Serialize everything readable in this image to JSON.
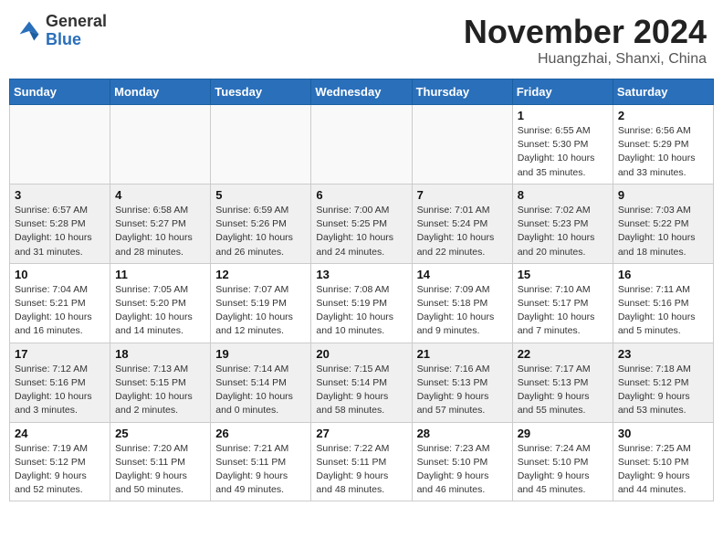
{
  "header": {
    "logo_general": "General",
    "logo_blue": "Blue",
    "month_title": "November 2024",
    "location": "Huangzhai, Shanxi, China"
  },
  "days_of_week": [
    "Sunday",
    "Monday",
    "Tuesday",
    "Wednesday",
    "Thursday",
    "Friday",
    "Saturday"
  ],
  "weeks": [
    {
      "shaded": false,
      "days": [
        {
          "num": "",
          "info": ""
        },
        {
          "num": "",
          "info": ""
        },
        {
          "num": "",
          "info": ""
        },
        {
          "num": "",
          "info": ""
        },
        {
          "num": "",
          "info": ""
        },
        {
          "num": "1",
          "info": "Sunrise: 6:55 AM\nSunset: 5:30 PM\nDaylight: 10 hours\nand 35 minutes."
        },
        {
          "num": "2",
          "info": "Sunrise: 6:56 AM\nSunset: 5:29 PM\nDaylight: 10 hours\nand 33 minutes."
        }
      ]
    },
    {
      "shaded": true,
      "days": [
        {
          "num": "3",
          "info": "Sunrise: 6:57 AM\nSunset: 5:28 PM\nDaylight: 10 hours\nand 31 minutes."
        },
        {
          "num": "4",
          "info": "Sunrise: 6:58 AM\nSunset: 5:27 PM\nDaylight: 10 hours\nand 28 minutes."
        },
        {
          "num": "5",
          "info": "Sunrise: 6:59 AM\nSunset: 5:26 PM\nDaylight: 10 hours\nand 26 minutes."
        },
        {
          "num": "6",
          "info": "Sunrise: 7:00 AM\nSunset: 5:25 PM\nDaylight: 10 hours\nand 24 minutes."
        },
        {
          "num": "7",
          "info": "Sunrise: 7:01 AM\nSunset: 5:24 PM\nDaylight: 10 hours\nand 22 minutes."
        },
        {
          "num": "8",
          "info": "Sunrise: 7:02 AM\nSunset: 5:23 PM\nDaylight: 10 hours\nand 20 minutes."
        },
        {
          "num": "9",
          "info": "Sunrise: 7:03 AM\nSunset: 5:22 PM\nDaylight: 10 hours\nand 18 minutes."
        }
      ]
    },
    {
      "shaded": false,
      "days": [
        {
          "num": "10",
          "info": "Sunrise: 7:04 AM\nSunset: 5:21 PM\nDaylight: 10 hours\nand 16 minutes."
        },
        {
          "num": "11",
          "info": "Sunrise: 7:05 AM\nSunset: 5:20 PM\nDaylight: 10 hours\nand 14 minutes."
        },
        {
          "num": "12",
          "info": "Sunrise: 7:07 AM\nSunset: 5:19 PM\nDaylight: 10 hours\nand 12 minutes."
        },
        {
          "num": "13",
          "info": "Sunrise: 7:08 AM\nSunset: 5:19 PM\nDaylight: 10 hours\nand 10 minutes."
        },
        {
          "num": "14",
          "info": "Sunrise: 7:09 AM\nSunset: 5:18 PM\nDaylight: 10 hours\nand 9 minutes."
        },
        {
          "num": "15",
          "info": "Sunrise: 7:10 AM\nSunset: 5:17 PM\nDaylight: 10 hours\nand 7 minutes."
        },
        {
          "num": "16",
          "info": "Sunrise: 7:11 AM\nSunset: 5:16 PM\nDaylight: 10 hours\nand 5 minutes."
        }
      ]
    },
    {
      "shaded": true,
      "days": [
        {
          "num": "17",
          "info": "Sunrise: 7:12 AM\nSunset: 5:16 PM\nDaylight: 10 hours\nand 3 minutes."
        },
        {
          "num": "18",
          "info": "Sunrise: 7:13 AM\nSunset: 5:15 PM\nDaylight: 10 hours\nand 2 minutes."
        },
        {
          "num": "19",
          "info": "Sunrise: 7:14 AM\nSunset: 5:14 PM\nDaylight: 10 hours\nand 0 minutes."
        },
        {
          "num": "20",
          "info": "Sunrise: 7:15 AM\nSunset: 5:14 PM\nDaylight: 9 hours\nand 58 minutes."
        },
        {
          "num": "21",
          "info": "Sunrise: 7:16 AM\nSunset: 5:13 PM\nDaylight: 9 hours\nand 57 minutes."
        },
        {
          "num": "22",
          "info": "Sunrise: 7:17 AM\nSunset: 5:13 PM\nDaylight: 9 hours\nand 55 minutes."
        },
        {
          "num": "23",
          "info": "Sunrise: 7:18 AM\nSunset: 5:12 PM\nDaylight: 9 hours\nand 53 minutes."
        }
      ]
    },
    {
      "shaded": false,
      "days": [
        {
          "num": "24",
          "info": "Sunrise: 7:19 AM\nSunset: 5:12 PM\nDaylight: 9 hours\nand 52 minutes."
        },
        {
          "num": "25",
          "info": "Sunrise: 7:20 AM\nSunset: 5:11 PM\nDaylight: 9 hours\nand 50 minutes."
        },
        {
          "num": "26",
          "info": "Sunrise: 7:21 AM\nSunset: 5:11 PM\nDaylight: 9 hours\nand 49 minutes."
        },
        {
          "num": "27",
          "info": "Sunrise: 7:22 AM\nSunset: 5:11 PM\nDaylight: 9 hours\nand 48 minutes."
        },
        {
          "num": "28",
          "info": "Sunrise: 7:23 AM\nSunset: 5:10 PM\nDaylight: 9 hours\nand 46 minutes."
        },
        {
          "num": "29",
          "info": "Sunrise: 7:24 AM\nSunset: 5:10 PM\nDaylight: 9 hours\nand 45 minutes."
        },
        {
          "num": "30",
          "info": "Sunrise: 7:25 AM\nSunset: 5:10 PM\nDaylight: 9 hours\nand 44 minutes."
        }
      ]
    }
  ]
}
